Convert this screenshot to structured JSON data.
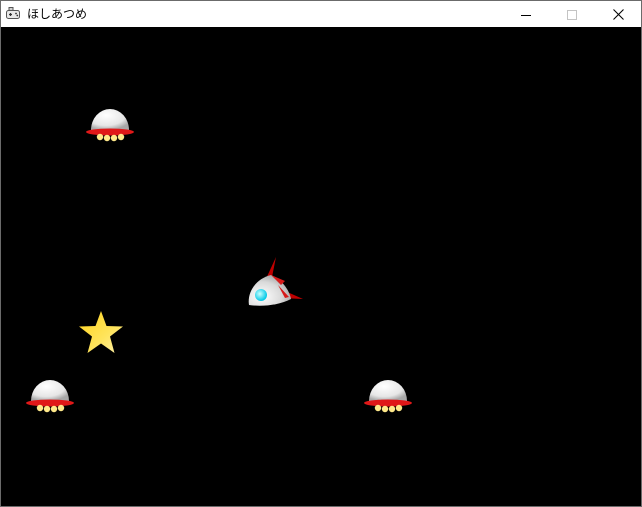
{
  "window": {
    "title": "ほしあつめ",
    "icon": "game-controller-icon",
    "controls": {
      "minimize_icon": "minimize-icon",
      "maximize_icon": "maximize-icon",
      "close_icon": "close-icon"
    }
  },
  "game": {
    "background_color": "#000000",
    "objects": {
      "player": {
        "type": "rocket-ship",
        "accent": "#cc0000",
        "window_color": "#00e5ff"
      },
      "enemies": [
        {
          "type": "ufo"
        },
        {
          "type": "ufo"
        },
        {
          "type": "ufo"
        }
      ],
      "star": {
        "type": "star",
        "color": "#ffd21a"
      }
    }
  }
}
